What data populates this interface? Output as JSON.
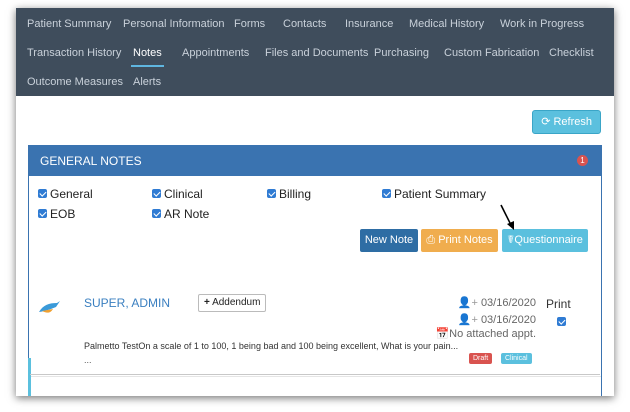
{
  "tabs_row1": [
    "Patient Summary",
    "Personal Information",
    "Forms",
    "Contacts",
    "Insurance",
    "Medical History",
    "Work in Progress"
  ],
  "tabs_row2": [
    "Transaction History",
    "Notes",
    "Appointments",
    "Files and Documents",
    "Purchasing",
    "Custom Fabrication",
    "Checklist"
  ],
  "tabs_row3": [
    "Outcome Measures",
    "Alerts"
  ],
  "active_tab": "Notes",
  "refresh_label": "Refresh",
  "panel": {
    "title": "GENERAL NOTES",
    "badge": "1"
  },
  "filters": [
    "General",
    "Clinical",
    "Billing",
    "Patient Summary",
    "EOB",
    "AR Note"
  ],
  "buttons": {
    "new_note": "New Note",
    "print_notes": "Print Notes",
    "questionnaire": "Questionnaire"
  },
  "note": {
    "author": "SUPER, ADMIN",
    "addendum_label": "Addendum",
    "created_date": "03/16/2020",
    "modified_date": "03/16/2020",
    "appointment": "No attached appt.",
    "print_label": "Print",
    "text": "Palmetto TestOn a scale of 1 to 100, 1 being bad and 100 being excellent, What is your pain...",
    "ellipsis": "...",
    "tags": [
      "Draft",
      "Clinical"
    ]
  },
  "colors": {
    "nav_bg": "#3f4d5c",
    "panel_blue": "#3a73b0",
    "info": "#5bc0de",
    "warning": "#f0ad4e",
    "danger": "#d9534f",
    "primary": "#2e6da4"
  }
}
